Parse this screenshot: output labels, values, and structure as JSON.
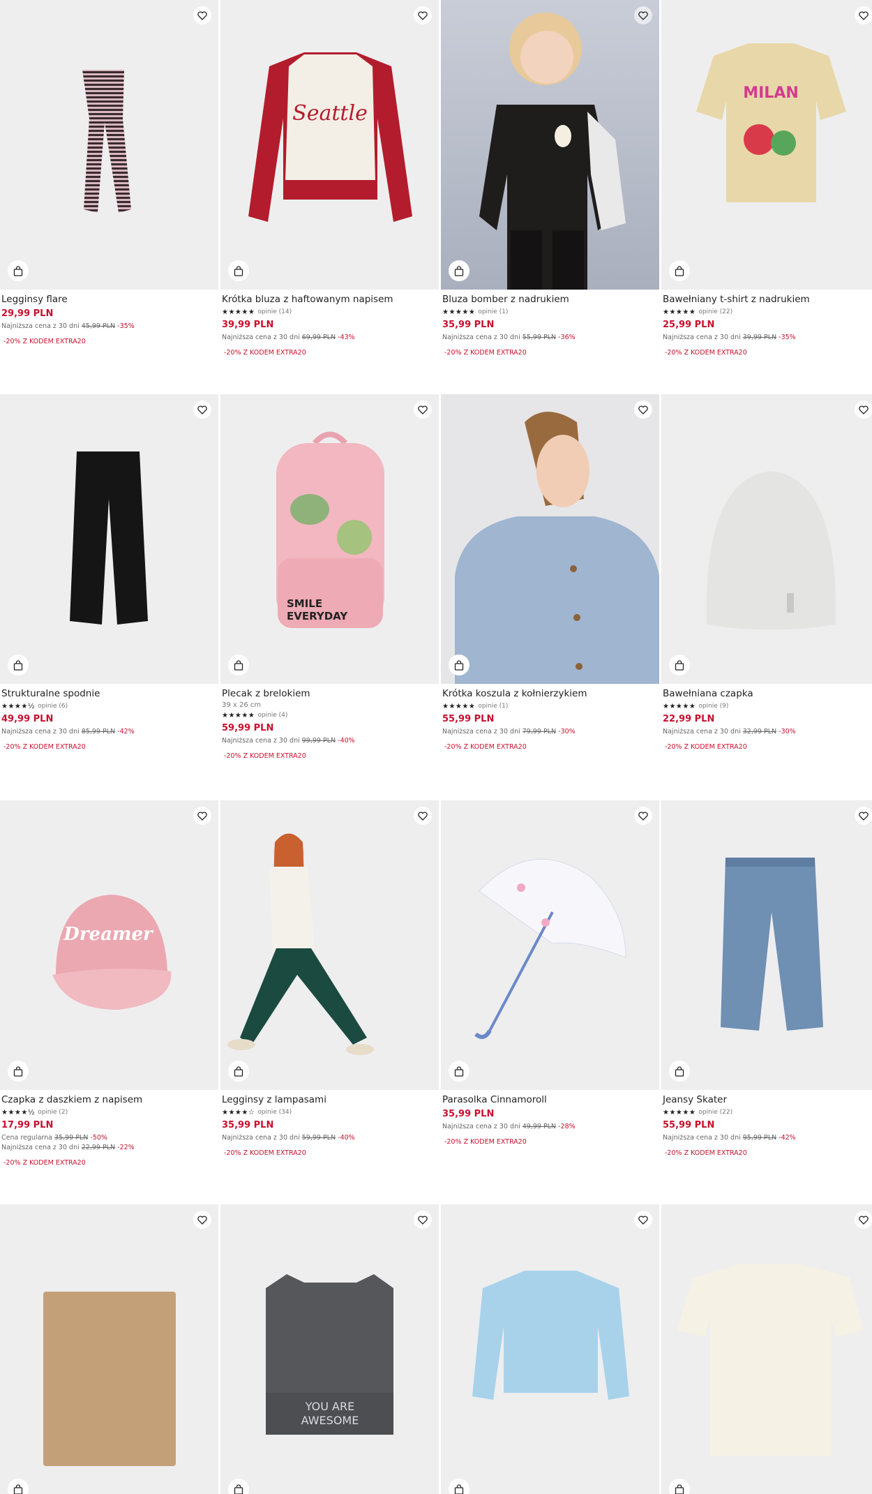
{
  "products": [
    {
      "name": "Legginsy flare",
      "dims": "",
      "stars": "",
      "reviews": "",
      "price": "29,99 PLN",
      "regular_label": "",
      "regular_price": "",
      "regular_disc": "",
      "lowest_label": "Najniższa cena z 30 dni",
      "lowest_price": "45,99 PLN",
      "lowest_disc": "-35%",
      "promo": "-20% Z KODEM EXTRA20",
      "icon": "leggings-stripe"
    },
    {
      "name": "Krótka bluza z haftowanym napisem",
      "dims": "",
      "stars": "★★★★★",
      "reviews": "opinie (14)",
      "price": "39,99 PLN",
      "regular_label": "",
      "regular_price": "",
      "regular_disc": "",
      "lowest_label": "Najniższa cena z 30 dni",
      "lowest_price": "69,99 PLN",
      "lowest_disc": "-43%",
      "promo": "-20% Z KODEM EXTRA20",
      "icon": "sweatshirt"
    },
    {
      "name": "Bluza bomber z nadrukiem",
      "dims": "",
      "stars": "★★★★★",
      "reviews": "opinie (1)",
      "price": "35,99 PLN",
      "regular_label": "",
      "regular_price": "",
      "regular_disc": "",
      "lowest_label": "Najniższa cena z 30 dni",
      "lowest_price": "55,99 PLN",
      "lowest_disc": "-36%",
      "promo": "-20% Z KODEM EXTRA20",
      "icon": "bomber"
    },
    {
      "name": "Bawełniany t-shirt z nadrukiem",
      "dims": "",
      "stars": "★★★★★",
      "reviews": "opinie (22)",
      "price": "25,99 PLN",
      "regular_label": "",
      "regular_price": "",
      "regular_disc": "",
      "lowest_label": "Najniższa cena z 30 dni",
      "lowest_price": "39,99 PLN",
      "lowest_disc": "-35%",
      "promo": "-20% Z KODEM EXTRA20",
      "icon": "tshirt"
    },
    {
      "name": "Strukturalne spodnie",
      "dims": "",
      "stars": "★★★★½",
      "reviews": "opinie (6)",
      "price": "49,99 PLN",
      "regular_label": "",
      "regular_price": "",
      "regular_disc": "",
      "lowest_label": "Najniższa cena z 30 dni",
      "lowest_price": "85,99 PLN",
      "lowest_disc": "-42%",
      "promo": "-20% Z KODEM EXTRA20",
      "icon": "trousers"
    },
    {
      "name": "Plecak z brelokiem",
      "dims": "39 x 26 cm",
      "stars": "★★★★★",
      "reviews": "opinie (4)",
      "price": "59,99 PLN",
      "regular_label": "",
      "regular_price": "",
      "regular_disc": "",
      "lowest_label": "Najniższa cena z 30 dni",
      "lowest_price": "99,99 PLN",
      "lowest_disc": "-40%",
      "promo": "-20% Z KODEM EXTRA20",
      "icon": "backpack"
    },
    {
      "name": "Krótka koszula z kołnierzykiem",
      "dims": "",
      "stars": "★★★★★",
      "reviews": "opinie (1)",
      "price": "55,99 PLN",
      "regular_label": "",
      "regular_price": "",
      "regular_disc": "",
      "lowest_label": "Najniższa cena z 30 dni",
      "lowest_price": "79,99 PLN",
      "lowest_disc": "-30%",
      "promo": "-20% Z KODEM EXTRA20",
      "icon": "shirt"
    },
    {
      "name": "Bawełniana czapka",
      "dims": "",
      "stars": "★★★★★",
      "reviews": "opinie (9)",
      "price": "22,99 PLN",
      "regular_label": "",
      "regular_price": "",
      "regular_disc": "",
      "lowest_label": "Najniższa cena z 30 dni",
      "lowest_price": "32,99 PLN",
      "lowest_disc": "-30%",
      "promo": "-20% Z KODEM EXTRA20",
      "icon": "beanie"
    },
    {
      "name": "Czapka z daszkiem z napisem",
      "dims": "",
      "stars": "★★★★½",
      "reviews": "opinie (2)",
      "price": "17,99 PLN",
      "regular_label": "Cena regularna",
      "regular_price": "35,99 PLN",
      "regular_disc": "-50%",
      "lowest_label": "Najniższa cena z 30 dni",
      "lowest_price": "22,99 PLN",
      "lowest_disc": "-22%",
      "promo": "-20% Z KODEM EXTRA20",
      "icon": "cap"
    },
    {
      "name": "Legginsy z lampasami",
      "dims": "",
      "stars": "★★★★☆",
      "reviews": "opinie (34)",
      "price": "35,99 PLN",
      "regular_label": "",
      "regular_price": "",
      "regular_disc": "",
      "lowest_label": "Najniższa cena z 30 dni",
      "lowest_price": "59,99 PLN",
      "lowest_disc": "-40%",
      "promo": "-20% Z KODEM EXTRA20",
      "icon": "leggings-green"
    },
    {
      "name": "Parasolka Cinnamoroll",
      "dims": "",
      "stars": "",
      "reviews": "",
      "price": "35,99 PLN",
      "regular_label": "",
      "regular_price": "",
      "regular_disc": "",
      "lowest_label": "Najniższa cena z 30 dni",
      "lowest_price": "49,99 PLN",
      "lowest_disc": "-28%",
      "promo": "-20% Z KODEM EXTRA20",
      "icon": "umbrella"
    },
    {
      "name": "Jeansy Skater",
      "dims": "",
      "stars": "★★★★★",
      "reviews": "opinie (22)",
      "price": "55,99 PLN",
      "regular_label": "",
      "regular_price": "",
      "regular_disc": "",
      "lowest_label": "Najniższa cena z 30 dni",
      "lowest_price": "95,99 PLN",
      "lowest_disc": "-42%",
      "promo": "-20% Z KODEM EXTRA20",
      "icon": "jeans"
    },
    {
      "name": "",
      "dims": "",
      "stars": "",
      "reviews": "",
      "price": "",
      "regular_label": "",
      "regular_price": "",
      "regular_disc": "",
      "lowest_label": "",
      "lowest_price": "",
      "lowest_disc": "",
      "promo": "",
      "icon": "snood"
    },
    {
      "name": "",
      "dims": "",
      "stars": "",
      "reviews": "",
      "price": "",
      "regular_label": "",
      "regular_price": "",
      "regular_disc": "",
      "lowest_label": "",
      "lowest_price": "",
      "lowest_disc": "",
      "promo": "",
      "icon": "cat-beanie"
    },
    {
      "name": "",
      "dims": "",
      "stars": "",
      "reviews": "",
      "price": "",
      "regular_label": "",
      "regular_price": "",
      "regular_disc": "",
      "lowest_label": "",
      "lowest_price": "",
      "lowest_disc": "",
      "promo": "",
      "icon": "blue-sweatshirt"
    },
    {
      "name": "",
      "dims": "",
      "stars": "",
      "reviews": "",
      "price": "",
      "regular_label": "",
      "regular_price": "",
      "regular_disc": "",
      "lowest_label": "",
      "lowest_price": "",
      "lowest_disc": "",
      "promo": "",
      "icon": "cream-tshirt"
    }
  ],
  "image_texts": {
    "sweatshirt": "Seattle",
    "backpack_1": "SMILE",
    "backpack_2": "EVERYDAY",
    "cap": "Dreamer",
    "cat_beanie_1": "YOU ARE",
    "cat_beanie_2": "AWESOME",
    "tshirt": "MILAN"
  },
  "colors": {
    "price": "#c8102e",
    "image_bg": "#eeeeef"
  },
  "icons": {
    "favorite": "heart-icon",
    "cart": "shopping-bag-icon"
  }
}
